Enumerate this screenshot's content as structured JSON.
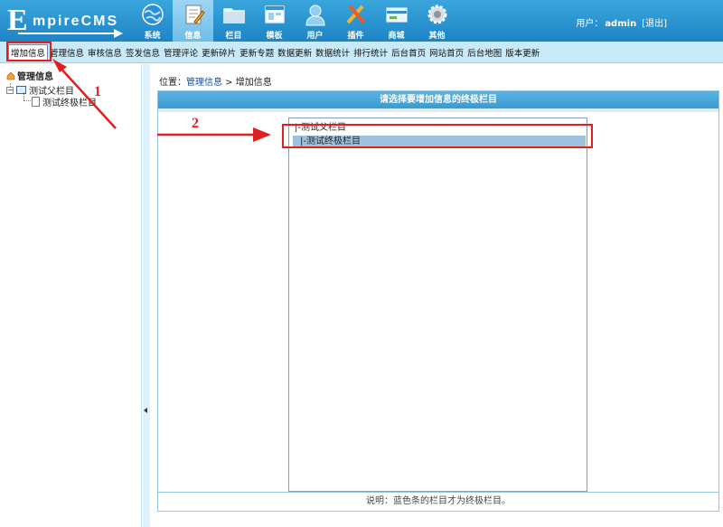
{
  "header": {
    "logo_initial": "E",
    "logo_rest": "mpireCMS",
    "nav": [
      {
        "label": "系统",
        "icon": "globe-icon",
        "active": false
      },
      {
        "label": "信息",
        "icon": "document-edit-icon",
        "active": true
      },
      {
        "label": "栏目",
        "icon": "folder-icon",
        "active": false
      },
      {
        "label": "模板",
        "icon": "window-template-icon",
        "active": false
      },
      {
        "label": "用户",
        "icon": "user-icon",
        "active": false
      },
      {
        "label": "插件",
        "icon": "tools-icon",
        "active": false
      },
      {
        "label": "商城",
        "icon": "card-icon",
        "active": false
      },
      {
        "label": "其他",
        "icon": "gear-icon",
        "active": false
      }
    ],
    "user_label": "用户：",
    "username": "admin",
    "logout": "[退出]"
  },
  "menubar": {
    "items": [
      "增加信息",
      "管理信息",
      "审核信息",
      "签发信息",
      "管理评论",
      "更新碎片",
      "更新专题",
      "数据更新",
      "数据统计",
      "排行统计",
      "后台首页",
      "网站首页",
      "后台地图",
      "版本更新"
    ],
    "selected_index": 0
  },
  "sidebar": {
    "title": "管理信息",
    "tree": [
      {
        "label": "测试父栏目",
        "level": 0,
        "toggle": "−"
      },
      {
        "label": "测试终极栏目",
        "level": 1
      }
    ]
  },
  "breadcrumb": {
    "prefix": "位置：",
    "link": "管理信息",
    "separator": " > ",
    "current": "增加信息"
  },
  "panel": {
    "title": "请选择要增加信息的终极栏目",
    "options": [
      {
        "label": "|-测试父栏目",
        "selected": false
      },
      {
        "label": "|-测试终极栏目",
        "selected": true
      }
    ],
    "note": "说明：蓝色条的栏目才为终极栏目。"
  },
  "annotations": {
    "marker1": "1",
    "marker2": "2"
  },
  "colors": {
    "header": "#1d84c6",
    "menubar": "#c7e9f8",
    "annotation": "#e01f1f",
    "selected_option": "#9cc2de"
  }
}
